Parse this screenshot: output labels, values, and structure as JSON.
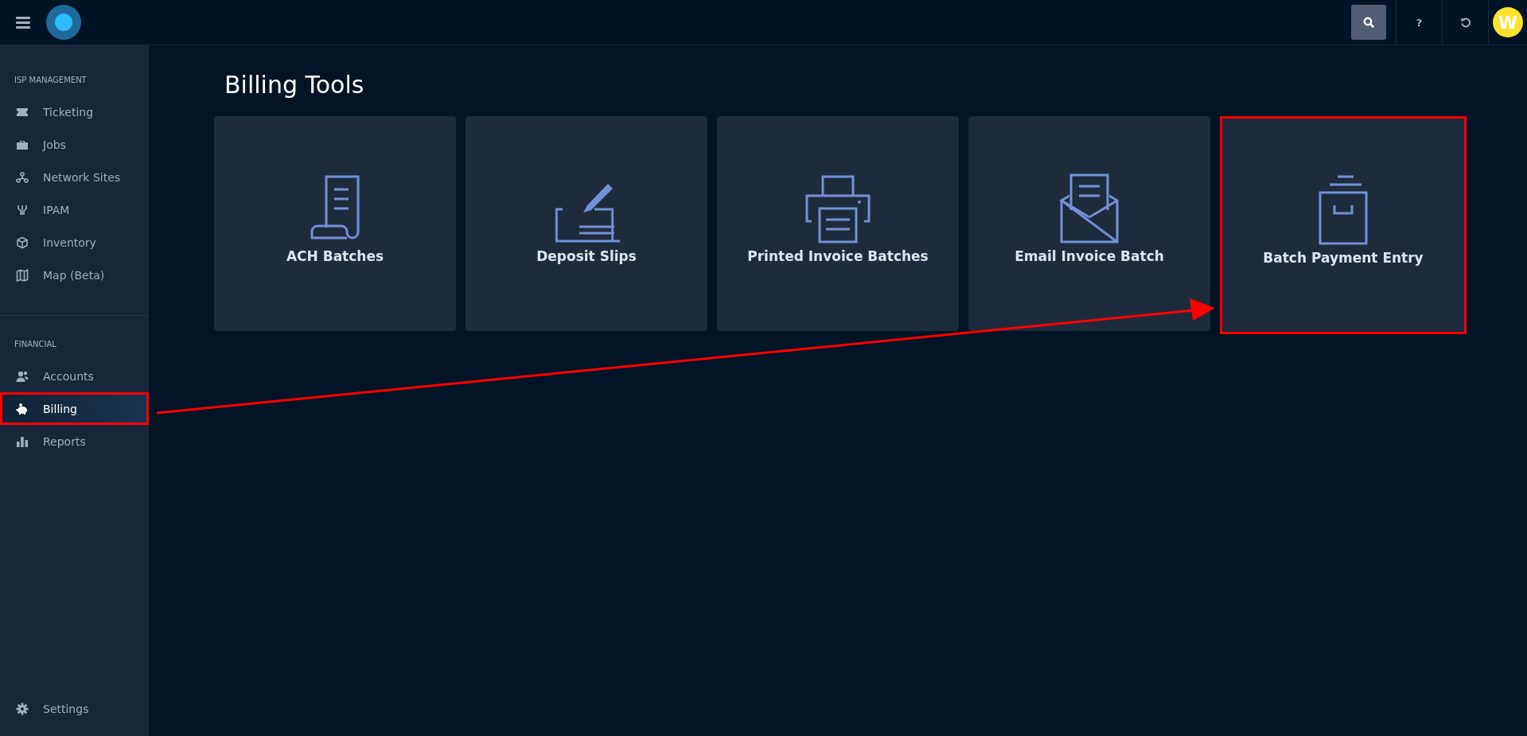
{
  "topbar": {
    "help_label": "?",
    "avatar_initial": "W"
  },
  "sidebar": {
    "sections": [
      {
        "heading": "ISP MANAGEMENT",
        "items": [
          {
            "label": "Ticketing",
            "selected": false,
            "annotated": false
          },
          {
            "label": "Jobs",
            "selected": false,
            "annotated": false
          },
          {
            "label": "Network Sites",
            "selected": false,
            "annotated": false
          },
          {
            "label": "IPAM",
            "selected": false,
            "annotated": false
          },
          {
            "label": "Inventory",
            "selected": false,
            "annotated": false
          },
          {
            "label": "Map (Beta)",
            "selected": false,
            "annotated": false
          }
        ]
      },
      {
        "heading": "FINANCIAL",
        "items": [
          {
            "label": "Accounts",
            "selected": false,
            "annotated": false
          },
          {
            "label": "Billing",
            "selected": true,
            "annotated": true
          },
          {
            "label": "Reports",
            "selected": false,
            "annotated": false
          }
        ]
      }
    ],
    "footer_item": {
      "label": "Settings"
    }
  },
  "page": {
    "title": "Billing Tools",
    "tools": [
      {
        "label": "ACH Batches",
        "annotated": false
      },
      {
        "label": "Deposit Slips",
        "annotated": false
      },
      {
        "label": "Printed Invoice Batches",
        "annotated": false
      },
      {
        "label": "Email Invoice Batch",
        "annotated": false
      },
      {
        "label": "Batch Payment Entry",
        "annotated": true
      }
    ]
  },
  "annotation_arrow": true
}
